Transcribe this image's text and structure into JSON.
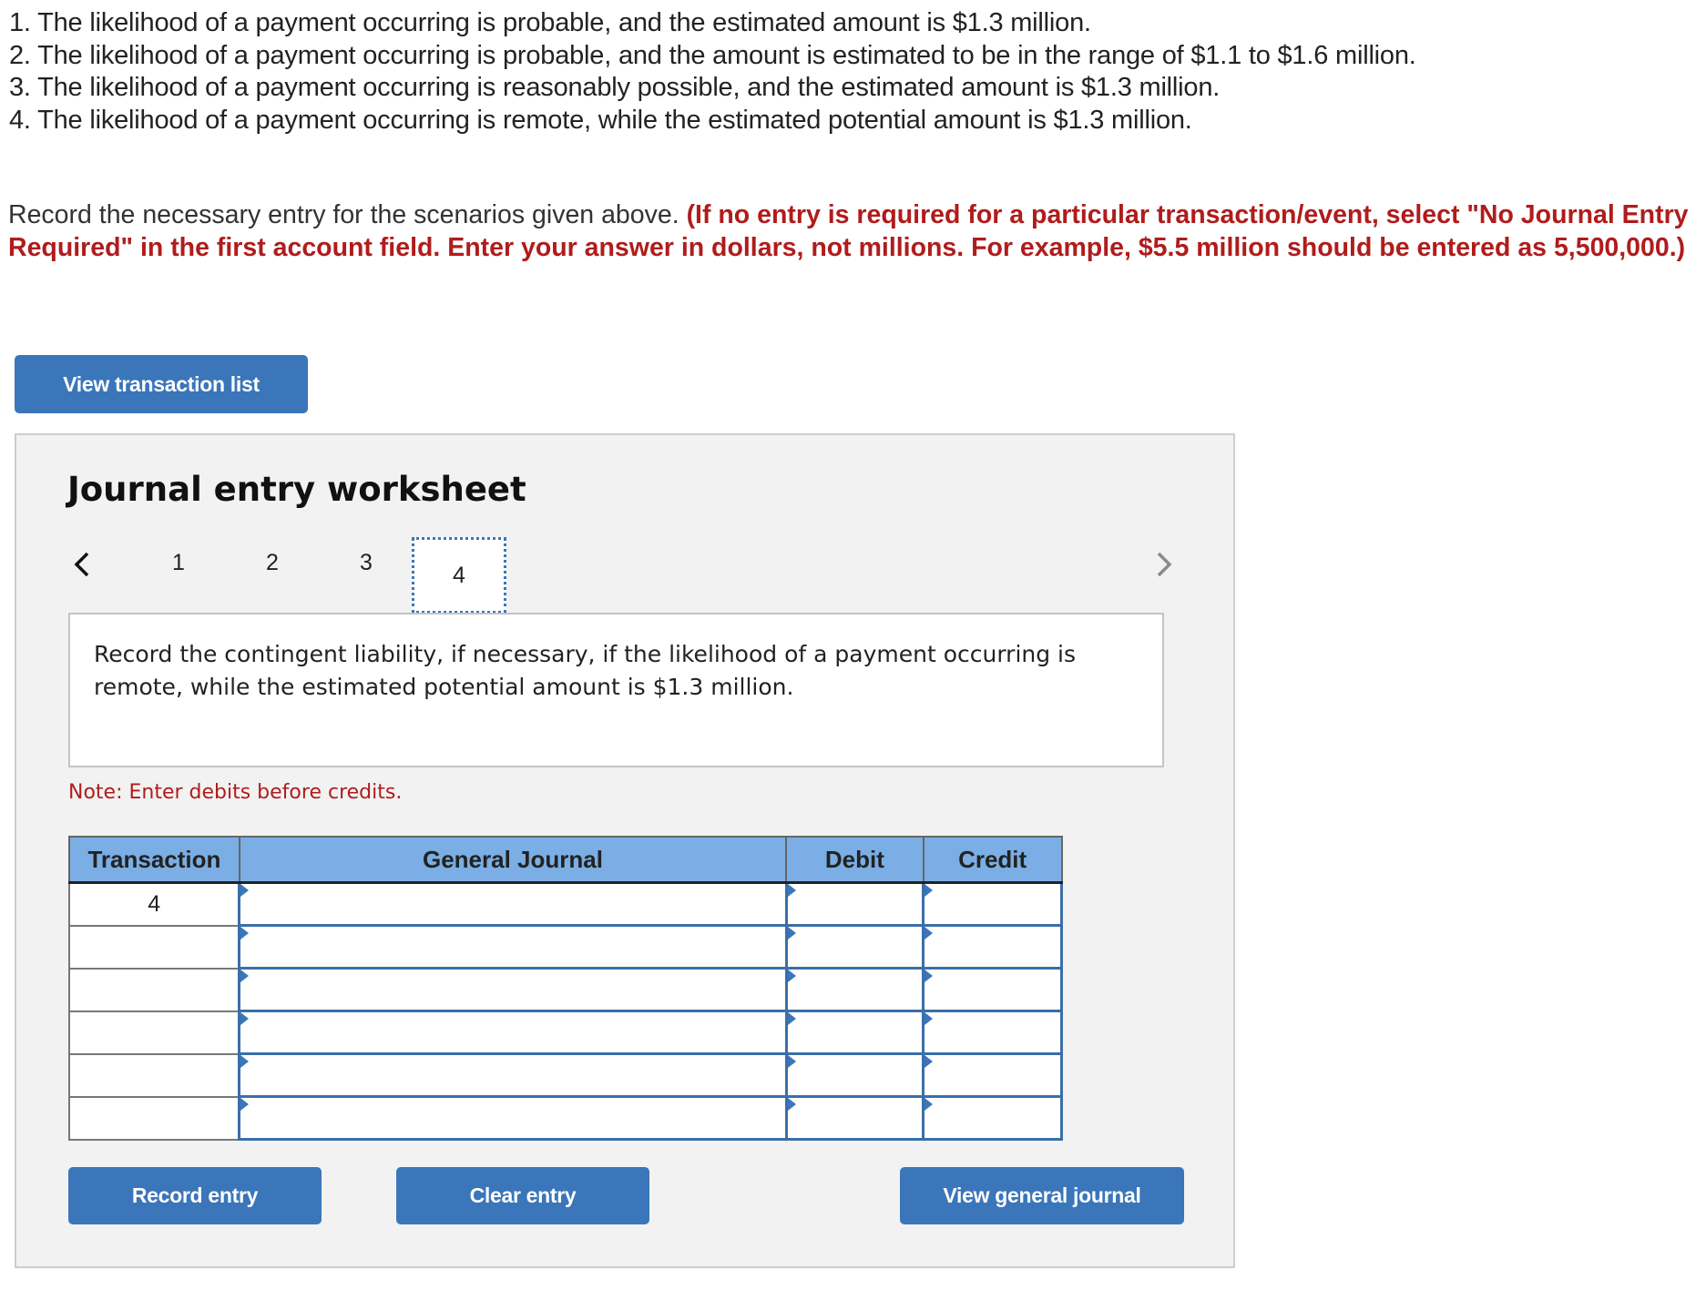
{
  "scenarios": [
    "1. The likelihood of a payment occurring is probable, and the estimated amount is $1.3 million.",
    "2. The likelihood of a payment occurring is probable, and the amount is estimated to be in the range of $1.1 to $1.6 million.",
    "3. The likelihood of a payment occurring is reasonably possible, and the estimated amount is $1.3 million.",
    "4. The likelihood of a payment occurring is remote, while the estimated potential amount is $1.3 million."
  ],
  "instructions": {
    "plain": "Record the necessary entry for the scenarios given above. ",
    "emphasis": "(If no entry is required for a particular transaction/event, select \"No Journal Entry Required\" in the first account field. Enter your answer in dollars, not millions. For example, $5.5 million should be entered as 5,500,000.)"
  },
  "view_transaction_list_label": "View transaction list",
  "worksheet": {
    "title": "Journal entry worksheet",
    "prev_icon": "chevron-left",
    "next_icon": "chevron-right",
    "tabs": [
      "1",
      "2",
      "3",
      "4"
    ],
    "active_tab": "4",
    "description": "Record the contingent liability, if necessary, if the likelihood of a payment occurring is remote, while the estimated potential amount is $1.3 million.",
    "note": "Note: Enter debits before credits.",
    "table": {
      "headers": [
        "Transaction",
        "General Journal",
        "Debit",
        "Credit"
      ],
      "rows": [
        {
          "transaction": "4",
          "account": "",
          "debit": "",
          "credit": ""
        },
        {
          "transaction": "",
          "account": "",
          "debit": "",
          "credit": ""
        },
        {
          "transaction": "",
          "account": "",
          "debit": "",
          "credit": ""
        },
        {
          "transaction": "",
          "account": "",
          "debit": "",
          "credit": ""
        },
        {
          "transaction": "",
          "account": "",
          "debit": "",
          "credit": ""
        },
        {
          "transaction": "",
          "account": "",
          "debit": "",
          "credit": ""
        }
      ]
    },
    "buttons": {
      "record": "Record entry",
      "clear": "Clear entry",
      "view_general_journal": "View general journal"
    }
  },
  "colors": {
    "accent": "#3a76b9",
    "header_bg": "#7aaee4",
    "emphasis_red": "#b01c1c",
    "panel_bg": "#f2f2f2"
  }
}
